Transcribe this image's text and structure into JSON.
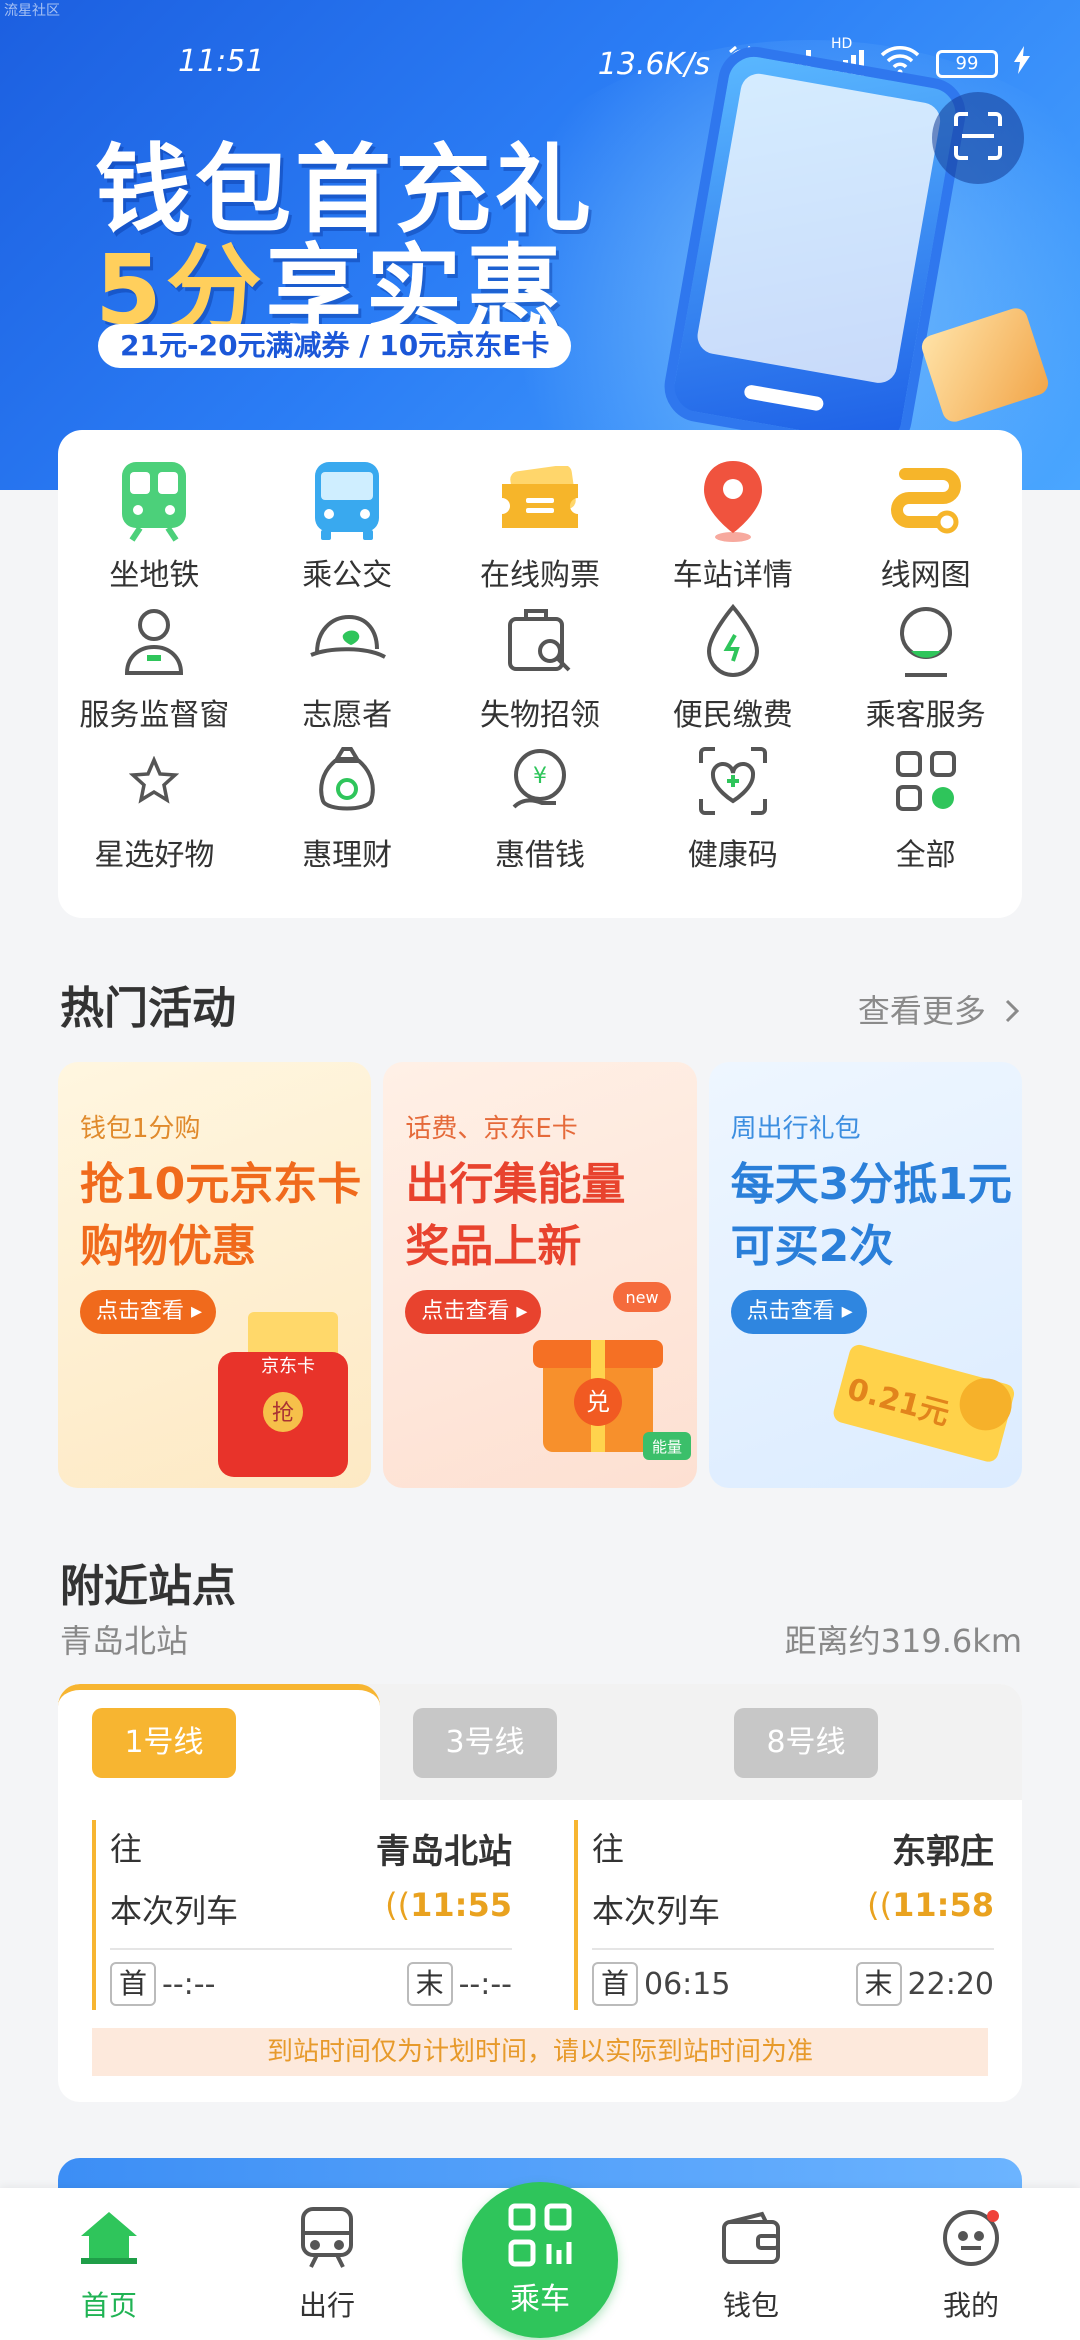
{
  "watermark": "流星社区",
  "status_bar": {
    "time": "11:51",
    "net_speed": "13.6K/s",
    "hd": "HD",
    "battery": "99"
  },
  "banner": {
    "title_line1": "钱包首充礼",
    "title_line2_highlight": "5分",
    "title_line2_rest": "享实惠",
    "subtitle": "21元-20元满减券 / 10元京东E卡"
  },
  "services": [
    {
      "label": "坐地铁",
      "icon": "subway-icon",
      "color": "#4cd07a"
    },
    {
      "label": "乘公交",
      "icon": "bus-icon",
      "color": "#39a9ef"
    },
    {
      "label": "在线购票",
      "icon": "ticket-icon",
      "color": "#f6b52a"
    },
    {
      "label": "车站详情",
      "icon": "location-pin-icon",
      "color": "#f0533e"
    },
    {
      "label": "线网图",
      "icon": "route-map-icon",
      "color": "#f6b52a"
    },
    {
      "label": "服务监督窗",
      "icon": "supervisor-icon",
      "color": "#555555"
    },
    {
      "label": "志愿者",
      "icon": "volunteer-cap-icon",
      "color": "#555555"
    },
    {
      "label": "失物招领",
      "icon": "lost-found-icon",
      "color": "#555555"
    },
    {
      "label": "便民缴费",
      "icon": "payment-drop-icon",
      "color": "#555555"
    },
    {
      "label": "乘客服务",
      "icon": "passenger-service-icon",
      "color": "#555555"
    },
    {
      "label": "星选好物",
      "icon": "star-icon",
      "color": "#555555"
    },
    {
      "label": "惠理财",
      "icon": "money-bag-icon",
      "color": "#555555"
    },
    {
      "label": "惠借钱",
      "icon": "loan-hand-icon",
      "color": "#555555"
    },
    {
      "label": "健康码",
      "icon": "health-code-icon",
      "color": "#555555"
    },
    {
      "label": "全部",
      "icon": "all-grid-icon",
      "color": "#555555"
    }
  ],
  "hot_activities": {
    "title": "热门活动",
    "more": "查看更多",
    "cards": [
      {
        "tag": "钱包1分购",
        "line1": "抢10元京东卡",
        "line2": "购物优惠",
        "cta": "点击查看",
        "art_label": "京东卡",
        "art_label2": "抢"
      },
      {
        "tag": "话费、京东E卡",
        "line1": "出行集能量",
        "line2": "奖品上新",
        "cta": "点击查看",
        "art_label": "new",
        "art_label2": "兑",
        "art_label3": "能量"
      },
      {
        "tag": "周出行礼包",
        "line1": "每天3分抵1元",
        "line2": "可买2次",
        "cta": "点击查看",
        "art_label": "0.21元"
      }
    ]
  },
  "nearby": {
    "title": "附近站点",
    "station": "青岛北站",
    "distance": "距离约319.6km",
    "tabs": [
      "1号线",
      "3号线",
      "8号线"
    ],
    "directions": [
      {
        "to_label": "往",
        "dest": "青岛北站",
        "next_label": "本次列车",
        "next_time": "11:55",
        "first_label": "首",
        "first_time": "--:--",
        "last_label": "末",
        "last_time": "--:--"
      },
      {
        "to_label": "往",
        "dest": "东郭庄",
        "next_label": "本次列车",
        "next_time": "11:58",
        "first_label": "首",
        "first_time": "06:15",
        "last_label": "末",
        "last_time": "22:20"
      }
    ],
    "notice": "到站时间仅为计划时间，请以实际到站时间为准"
  },
  "bottom_nav": {
    "home": "首页",
    "travel": "出行",
    "ride": "乘车",
    "wallet": "钱包",
    "mine": "我的"
  },
  "colors": {
    "primary_green": "#2fc55b",
    "line_yellow": "#f7b531",
    "banner_blue": "#2b7df5"
  }
}
